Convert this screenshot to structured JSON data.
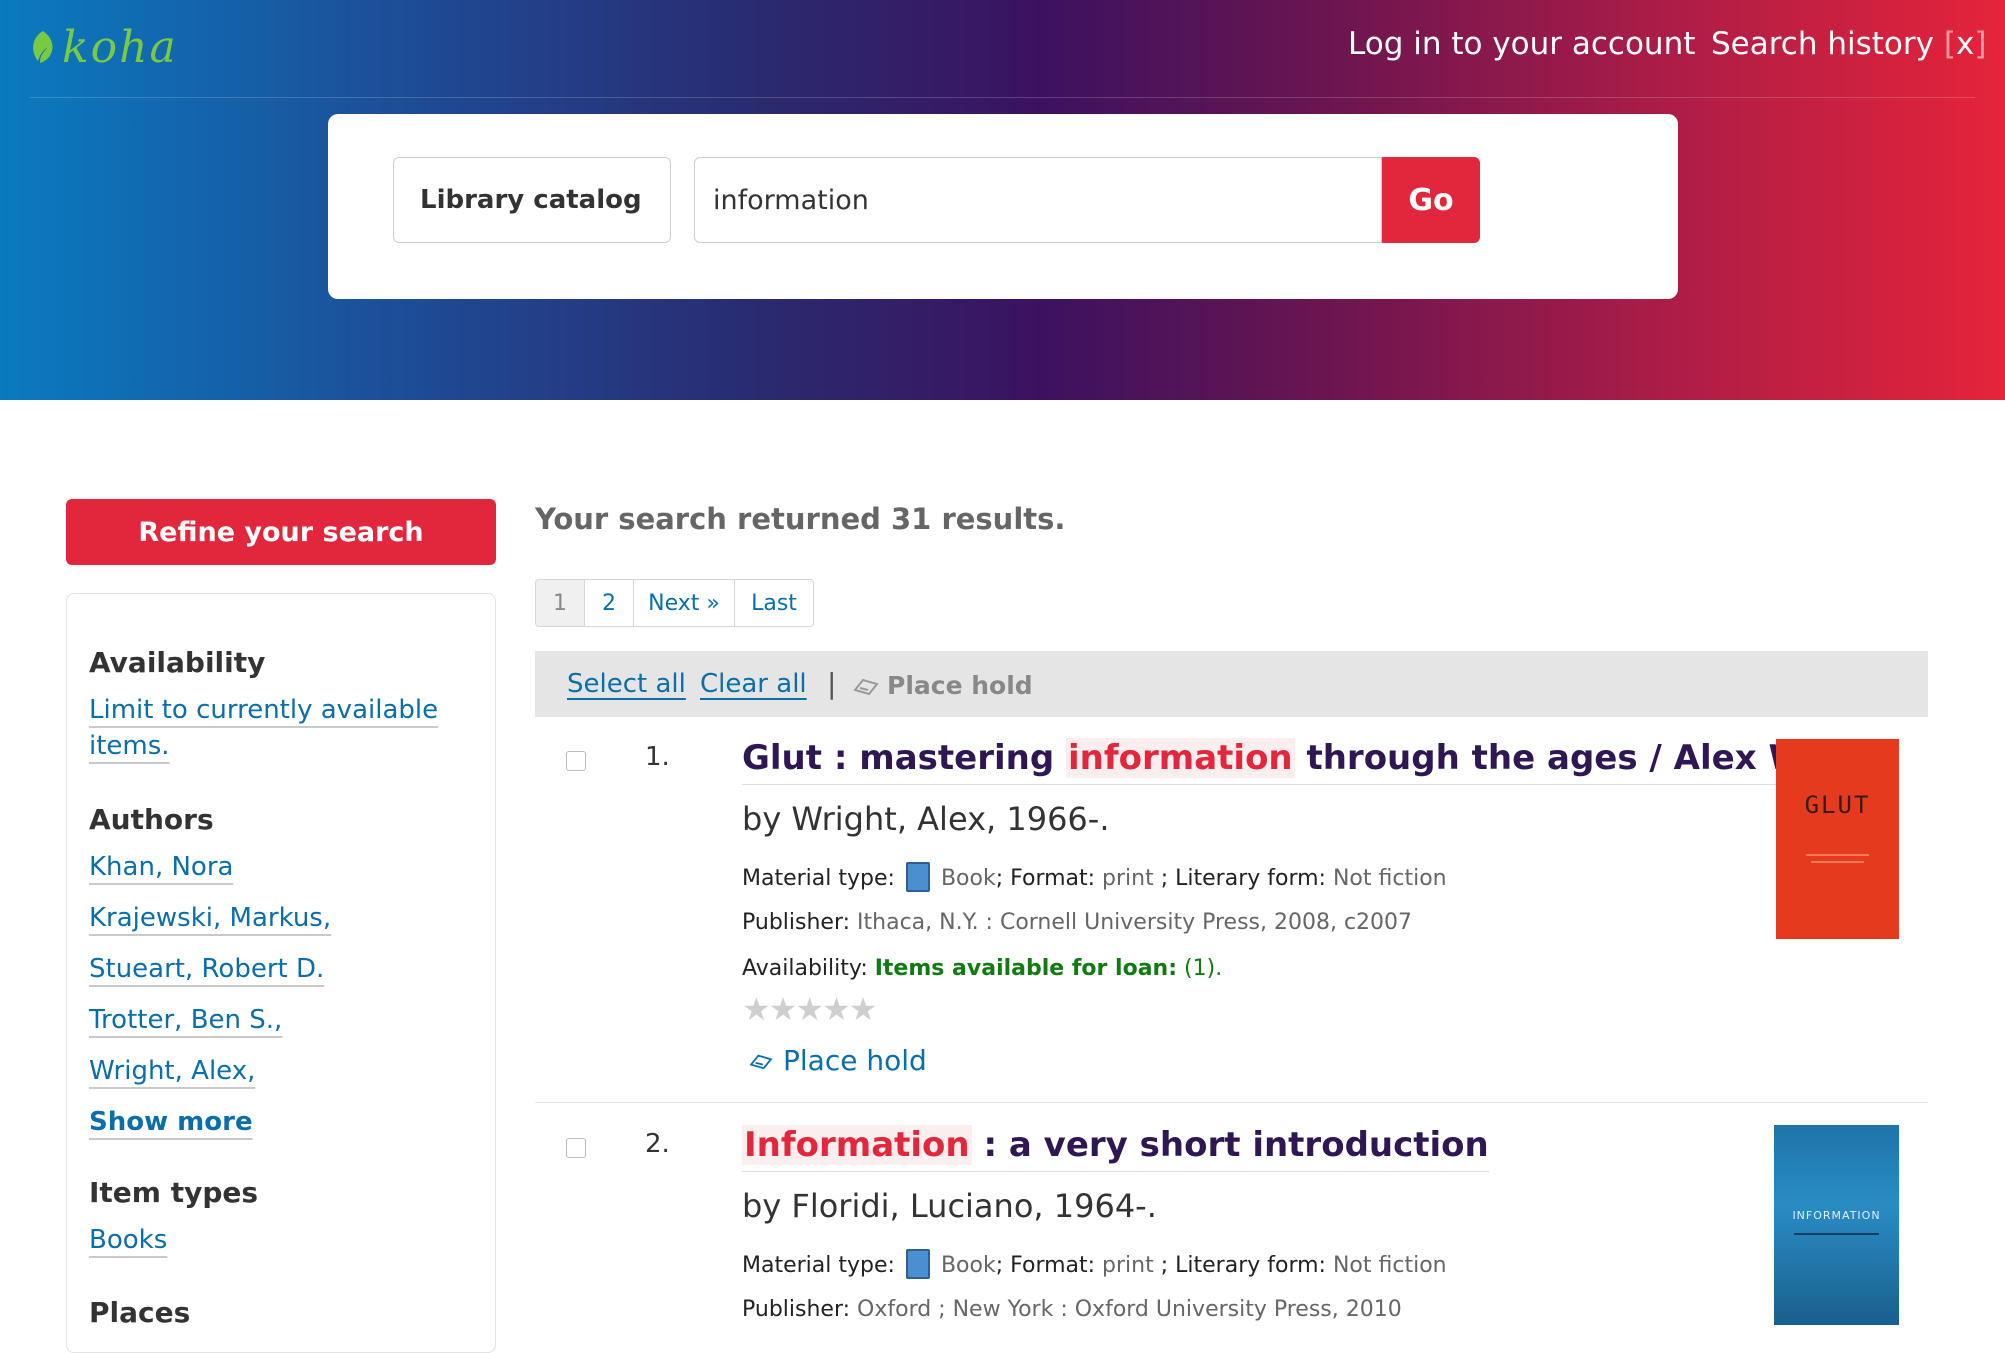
{
  "header": {
    "logo_text": "koha",
    "login_link": "Log in to your account",
    "search_history": "Search history",
    "history_clear": "x",
    "colors": {
      "gradient_start": "#0a7bc0",
      "gradient_mid": "#3c1260",
      "gradient_end": "#e6243a"
    }
  },
  "search": {
    "catalog_select": "Library catalog",
    "query": "information",
    "go_label": "Go"
  },
  "sidebar": {
    "refine_label": "Refine your search",
    "availability_heading": "Availability",
    "availability_link_line1": "Limit to currently available",
    "availability_link_line2": "items.",
    "authors_heading": "Authors",
    "authors": [
      "Khan, Nora",
      "Krajewski, Markus,",
      "Stueart, Robert D.",
      "Trotter, Ben S.,",
      "Wright, Alex,"
    ],
    "show_more": "Show more",
    "item_types_heading": "Item types",
    "item_types": [
      "Books"
    ],
    "places_heading": "Places"
  },
  "results": {
    "count_text": "Your search returned 31 results.",
    "pager": [
      "1",
      "2",
      "Next »",
      "Last"
    ],
    "select_all": "Select all",
    "clear_all": "Clear all",
    "separator": "|",
    "toolbar_place_hold": "Place hold",
    "items": [
      {
        "number": "1.",
        "title_pre": "Glut : mastering ",
        "title_hl": "information",
        "title_post": " through the ages / Alex Wright",
        "author": "by Wright, Alex, 1966-.",
        "material_label": "Material type:",
        "material_value": "Book",
        "format_label": "; Format:",
        "format_value": "print",
        "literary_label": " ; Literary form:",
        "literary_value": "Not fiction",
        "publisher_label": "Publisher:",
        "publisher_value": "Ithaca, N.Y. : Cornell University Press, 2008, c2007",
        "availability_label": "Availability:",
        "availability_value": "Items available for loan:",
        "availability_count": "(1).",
        "stars": "★★★★★",
        "place_hold": "Place hold",
        "cover_text": "GLUT"
      },
      {
        "number": "2.",
        "title_hl": "Information",
        "title_post": " : a very short introduction",
        "author": "by Floridi, Luciano, 1964-.",
        "material_label": "Material type:",
        "material_value": "Book",
        "format_label": "; Format:",
        "format_value": "print",
        "literary_label": " ; Literary form:",
        "literary_value": "Not fiction",
        "publisher_label": "Publisher:",
        "publisher_value": "Oxford ; New York : Oxford University Press, 2010",
        "cover_text": "INFORMATION"
      }
    ]
  }
}
